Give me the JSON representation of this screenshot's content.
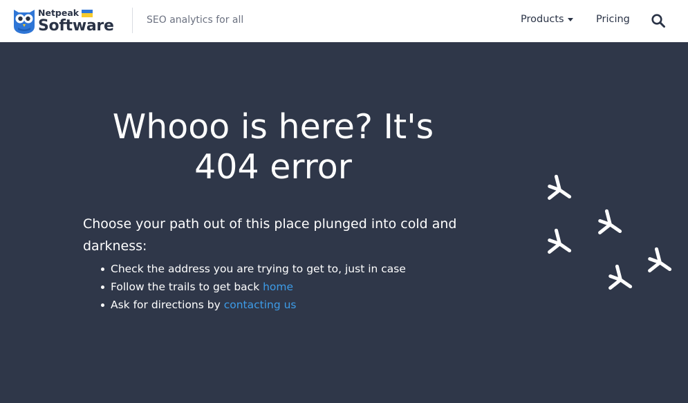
{
  "header": {
    "logo": {
      "top_text": "Netpeak",
      "bottom_text": "Software",
      "alt": "Netpeak Software"
    },
    "tagline": "SEO analytics for all",
    "nav": {
      "products_label": "Products",
      "pricing_label": "Pricing"
    }
  },
  "main": {
    "title": "Whooo is here? It's 404 error",
    "lead": "Choose your path out of this place plunged into cold and darkness:",
    "items": [
      {
        "text": "Check the address you are trying to get to, just in case",
        "link": ""
      },
      {
        "text": "Follow the trails to get back ",
        "link": "home"
      },
      {
        "text": "Ask for directions by ",
        "link": "contacting us"
      }
    ]
  },
  "colors": {
    "background": "#2f3749",
    "header_bg": "#ffffff",
    "link": "#3d9ce8",
    "logo_blue": "#2f76d6",
    "flag_yellow": "#f7cb2d"
  },
  "icons": [
    "owl-logo-icon",
    "ukraine-flag-icon",
    "caret-down-icon",
    "search-icon",
    "bird-track-icon"
  ]
}
